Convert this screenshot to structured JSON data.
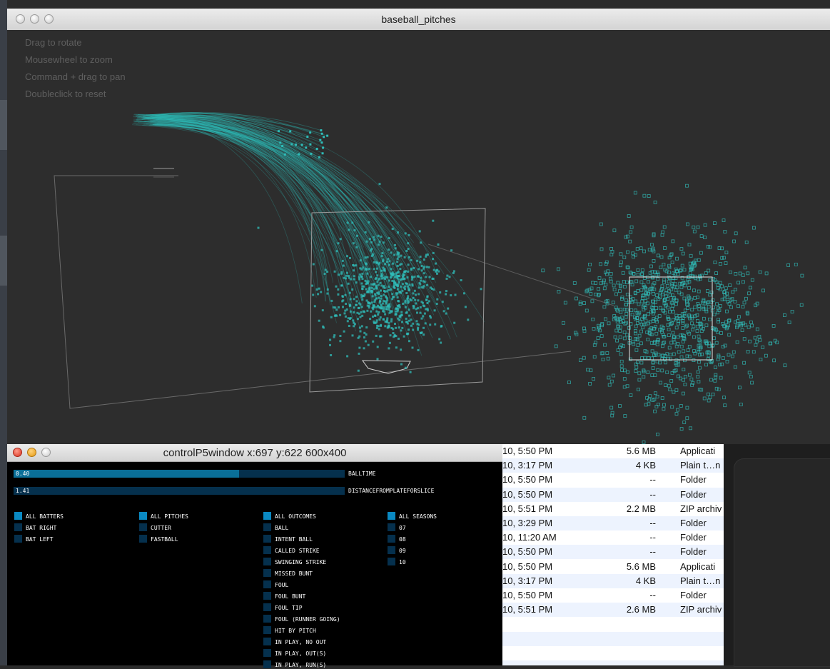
{
  "main_window": {
    "title": "baseball_pitches",
    "hints": [
      "Drag to rotate",
      "Mousewheel to zoom",
      "Command + drag to pan",
      "Doubleclick to reset"
    ]
  },
  "control_window": {
    "title": "controlP5window x:697 y:622  600x400",
    "sliders": [
      {
        "label": "BALLTIME",
        "value_text": "0.40",
        "fill_fraction": 0.68
      },
      {
        "label": "DISTANCEFROMPLATEFORSLICE",
        "value_text": "1.41",
        "fill_fraction": 0.0
      }
    ],
    "groups": [
      {
        "items": [
          {
            "label": "ALL BATTERS",
            "on": true
          },
          {
            "label": "BAT RIGHT",
            "on": false
          },
          {
            "label": "BAT LEFT",
            "on": false
          }
        ]
      },
      {
        "items": [
          {
            "label": "ALL PITCHES",
            "on": true
          },
          {
            "label": "CUTTER",
            "on": false
          },
          {
            "label": "FASTBALL",
            "on": false
          }
        ]
      },
      {
        "items": [
          {
            "label": "ALL OUTCOMES",
            "on": true
          },
          {
            "label": "BALL",
            "on": false
          },
          {
            "label": "INTENT BALL",
            "on": false
          },
          {
            "label": "CALLED STRIKE",
            "on": false
          },
          {
            "label": "SWINGING STRIKE",
            "on": false
          },
          {
            "label": "MISSED BUNT",
            "on": false
          },
          {
            "label": "FOUL",
            "on": false
          },
          {
            "label": "FOUL BUNT",
            "on": false
          },
          {
            "label": "FOUL TIP",
            "on": false
          },
          {
            "label": "FOUL (RUNNER GOING)",
            "on": false
          },
          {
            "label": "HIT BY PITCH",
            "on": false
          },
          {
            "label": "IN PLAY, NO OUT",
            "on": false
          },
          {
            "label": "IN PLAY, OUT(S)",
            "on": false
          },
          {
            "label": "IN PLAY, RUN(S)",
            "on": false
          }
        ]
      },
      {
        "items": [
          {
            "label": "ALL SEASONS",
            "on": true
          },
          {
            "label": "07",
            "on": false
          },
          {
            "label": "08",
            "on": false
          },
          {
            "label": "09",
            "on": false
          },
          {
            "label": "10",
            "on": false
          }
        ]
      }
    ]
  },
  "finder_rows": [
    {
      "date": "10, 5:50 PM",
      "size": "5.6 MB",
      "kind": "Applicati"
    },
    {
      "date": "10, 3:17 PM",
      "size": "4 KB",
      "kind": "Plain t…n"
    },
    {
      "date": "10, 5:50 PM",
      "size": "--",
      "kind": "Folder"
    },
    {
      "date": "10, 5:50 PM",
      "size": "--",
      "kind": "Folder"
    },
    {
      "date": "10, 5:51 PM",
      "size": "2.2 MB",
      "kind": "ZIP archiv"
    },
    {
      "date": "10, 3:29 PM",
      "size": "--",
      "kind": "Folder"
    },
    {
      "date": "10, 11:20 AM",
      "size": "--",
      "kind": "Folder"
    },
    {
      "date": "10, 5:50 PM",
      "size": "--",
      "kind": "Folder"
    },
    {
      "date": "10, 5:50 PM",
      "size": "5.6 MB",
      "kind": "Applicati"
    },
    {
      "date": "10, 3:17 PM",
      "size": "4 KB",
      "kind": "Plain t…n"
    },
    {
      "date": "10, 5:50 PM",
      "size": "--",
      "kind": "Folder"
    },
    {
      "date": "10, 5:51 PM",
      "size": "2.6 MB",
      "kind": "ZIP archiv"
    }
  ],
  "colors": {
    "pitch": "#2fbcb8",
    "toggle_on": "#0a89c2",
    "toggle_off": "#05304d"
  }
}
